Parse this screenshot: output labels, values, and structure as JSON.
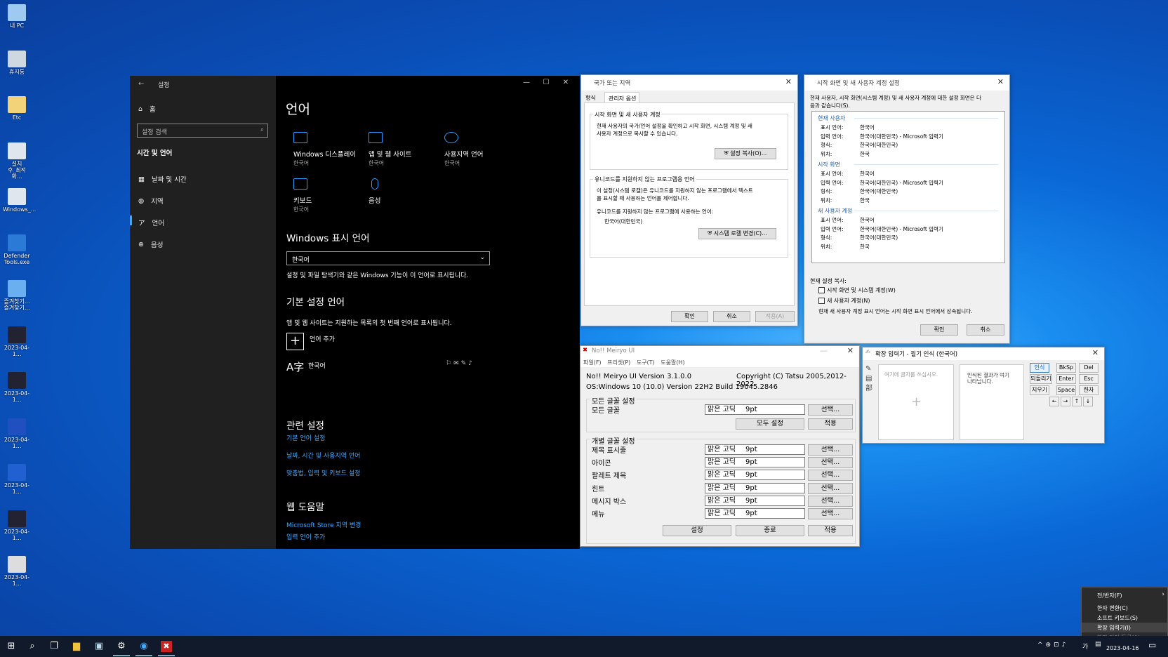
{
  "desktop": {
    "icons": [
      "내 PC",
      "휴지통",
      "Etc",
      "설치\n후_최적화...",
      "Windows_...",
      "Defender\nTools.exe",
      "즐겨찾기...\n즐겨찾기...",
      "2023-04-1...",
      "2023-04-1...",
      "2023-04-1...",
      "2023-04-1...",
      "2023-04-1...",
      "2023-04-1..."
    ]
  },
  "settings": {
    "title": "설정",
    "home": "홈",
    "search_placeholder": "설정 검색",
    "category": "시간 및 언어",
    "nav": [
      "날짜 및 시간",
      "지역",
      "언어",
      "음성"
    ],
    "heading": "언어",
    "tiles": [
      {
        "label": "Windows 디스플레이",
        "sub": "한국어"
      },
      {
        "label": "앱 및 웹 사이트",
        "sub": "한국어"
      },
      {
        "label": "사용지역 언어",
        "sub": "한국어"
      },
      {
        "label": "키보드",
        "sub": "한국어"
      },
      {
        "label": "음성",
        "sub": ""
      }
    ],
    "display_lang_title": "Windows 표시 언어",
    "display_lang_value": "한국어",
    "display_lang_desc": "설정 및 파일 탐색기와 같은 Windows 기능이 이 언어로 표시됩니다.",
    "pref_title": "기본 설정 언어",
    "pref_desc": "앱 및 웹 사이트는 지원하는 목록의 첫 번째 언어로 표시됩니다.",
    "add_lang": "언어 추가",
    "lang_item": "한국어",
    "related_title": "관련 설정",
    "related_links": [
      "기본 언어 설정",
      "날짜, 시간 및 사용지역 언어",
      "맞춤법, 입력 및 키보드 설정"
    ],
    "web_title": "웹 도움말",
    "web_links": [
      "Microsoft Store 지역 변경",
      "입력 언어 추가"
    ]
  },
  "region": {
    "title": "국가 또는 지역",
    "tabs": [
      "형식",
      "관리자 옵션"
    ],
    "group1_title": "시작 화면 및 새 사용자 계정",
    "group1_desc1": "현재 사용자의 국가/언어 설정을 확인하고 시작 화면, 시스템 계정 및 새",
    "group1_desc2": "사용자 계정으로 복사할 수 있습니다.",
    "copy_btn": "설정 복사(O)...",
    "group2_title": "유니코드를 지원하지 않는 프로그램용 언어",
    "group2_desc1": "이 설정(시스템 로캘)은 유니코드를 지원하지 않는 프로그램에서 텍스트",
    "group2_desc2": "를 표시할 때 사용하는 언어를 제어합니다.",
    "group2_label": "유니코드를 지원하지 않는 프로그램에 사용하는 언어:",
    "group2_value": "한국어(대한민국)",
    "locale_btn": "시스템 로캘 변경(C)...",
    "ok": "확인",
    "cancel": "취소",
    "apply": "적용(A)"
  },
  "welcome": {
    "title": "시작 화면 및 새 사용자 계정 설정",
    "desc1": "현재 사용자, 시작 화면(시스템 계정) 및 새 사용자 계정에 대한 설정 화면은 다",
    "desc2": "음과 같습니다(S).",
    "sections": [
      {
        "name": "현재 사용자",
        "rows": [
          [
            "표시 언어:",
            "한국어"
          ],
          [
            "입력 언어:",
            "한국어(대한민국) - Microsoft 입력기"
          ],
          [
            "형식:",
            "한국어(대한민국)"
          ],
          [
            "위치:",
            "한국"
          ]
        ]
      },
      {
        "name": "시작 화면",
        "rows": [
          [
            "표시 언어:",
            "한국어"
          ],
          [
            "입력 언어:",
            "한국어(대한민국) - Microsoft 입력기"
          ],
          [
            "형식:",
            "한국어(대한민국)"
          ],
          [
            "위치:",
            "한국"
          ]
        ]
      },
      {
        "name": "새 사용자 계정",
        "rows": [
          [
            "표시 언어:",
            "한국어"
          ],
          [
            "입력 언어:",
            "한국어(대한민국) - Microsoft 입력기"
          ],
          [
            "형식:",
            "한국어(대한민국)"
          ],
          [
            "위치:",
            "한국"
          ]
        ]
      }
    ],
    "copy_title": "현재 설정 복사:",
    "chk1": "시작 화면 및 시스템 계정(W)",
    "chk2": "새 사용자 계정(N)",
    "note": "현재 새 사용자 계정 표시 언어는 시작 화면 표시 언어에서 상속됩니다.",
    "ok": "확인",
    "cancel": "취소"
  },
  "meiryo": {
    "title": "No!! Meiryo UI",
    "menu": [
      "파일(F)",
      "프리셋(P)",
      "도구(T)",
      "도움말(H)"
    ],
    "version": "No!! Meiryo UI Version 3.1.0.0",
    "copyright": "Copyright (C) Tatsu 2005,2012-2022",
    "os": "OS:Windows 10 (10.0) Version 22H2 Build 19045.2846",
    "all_group": "모든 글꼴 설정",
    "all_label": "모든 글꼴",
    "font": "맑은 고딕",
    "size": "9pt",
    "select": "선택...",
    "all_set": "모두 설정",
    "apply": "적용",
    "indiv_group": "개별 글꼴 설정",
    "items": [
      "제목 표시줄",
      "아이콘",
      "팔레트 제목",
      "힌트",
      "메시지 박스",
      "메뉴"
    ],
    "settings_btn": "설정",
    "exit_btn": "종료"
  },
  "handime": {
    "title": "확장 입력기 - 필기 인식 (한국어)",
    "input_hint": "여기에 글자를 쓰십시오.",
    "result_hint": "인식된 결과가 여기 나타납니다.",
    "recognize": "인식",
    "undo": "되돌리기",
    "erase": "지우기",
    "keys": [
      "BkSp",
      "Del",
      "Enter",
      "Esc",
      "Space",
      "한자",
      "←",
      "→",
      "↑",
      "↓"
    ]
  },
  "ime_menu": {
    "items": [
      "전/반자(F)",
      "한자 변환(C)",
      "소프트 키보드(S)",
      "확장 입력기(I)",
      "한자 단어 등록(A)"
    ]
  },
  "taskbar": {
    "date": "2023-04-16",
    "tray_ime": "가"
  }
}
